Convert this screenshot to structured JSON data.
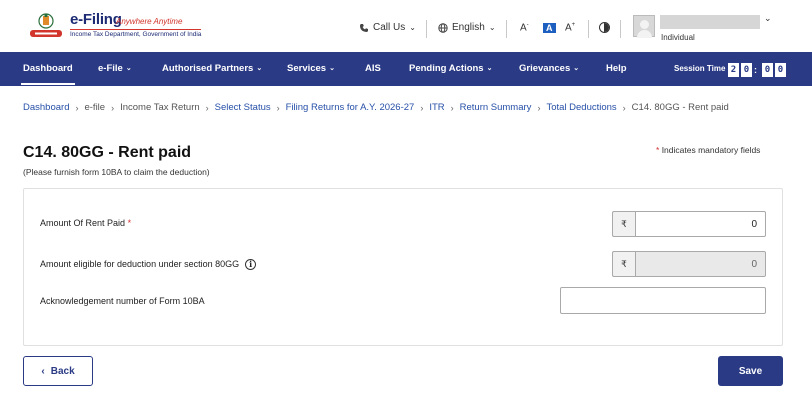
{
  "header": {
    "logo_title": "e-Filing",
    "logo_tagline": "Anywhere Anytime",
    "logo_subtitle": "Income Tax Department, Government of India",
    "call_us": "Call Us",
    "language": "English",
    "font_decrease": "A",
    "font_default": "A",
    "font_increase": "A",
    "user_role": "Individual"
  },
  "nav": {
    "items": [
      {
        "label": "Dashboard"
      },
      {
        "label": "e-File"
      },
      {
        "label": "Authorised Partners"
      },
      {
        "label": "Services"
      },
      {
        "label": "AIS"
      },
      {
        "label": "Pending Actions"
      },
      {
        "label": "Grievances"
      },
      {
        "label": "Help"
      }
    ],
    "session_label": "Session Time",
    "session_digits": [
      "2",
      "0",
      "0",
      "0"
    ]
  },
  "breadcrumb": [
    "Dashboard",
    "e-file",
    "Income Tax Return",
    "Select Status",
    "Filing Returns for A.Y. 2026-27",
    "ITR",
    "Return Summary",
    "Total Deductions",
    "C14. 80GG - Rent paid"
  ],
  "page": {
    "title": "C14. 80GG - Rent paid",
    "subtitle": "(Please furnish form 10BA to claim the deduction)",
    "mandatory_note": "Indicates mandatory fields",
    "required_mark": "*"
  },
  "form": {
    "rent_paid_label": "Amount Of Rent Paid",
    "rent_paid_value": "0",
    "eligible_label": "Amount eligible for deduction under section 80GG",
    "eligible_value": "0",
    "ack_label": "Acknowledgement number of Form 10BA",
    "ack_value": "",
    "currency_symbol": "₹",
    "info_glyph": "i"
  },
  "buttons": {
    "back": "Back",
    "save": "Save"
  },
  "colors": {
    "nav_bg": "#2a3a85",
    "link": "#2750a8",
    "required": "#d32f2f"
  }
}
